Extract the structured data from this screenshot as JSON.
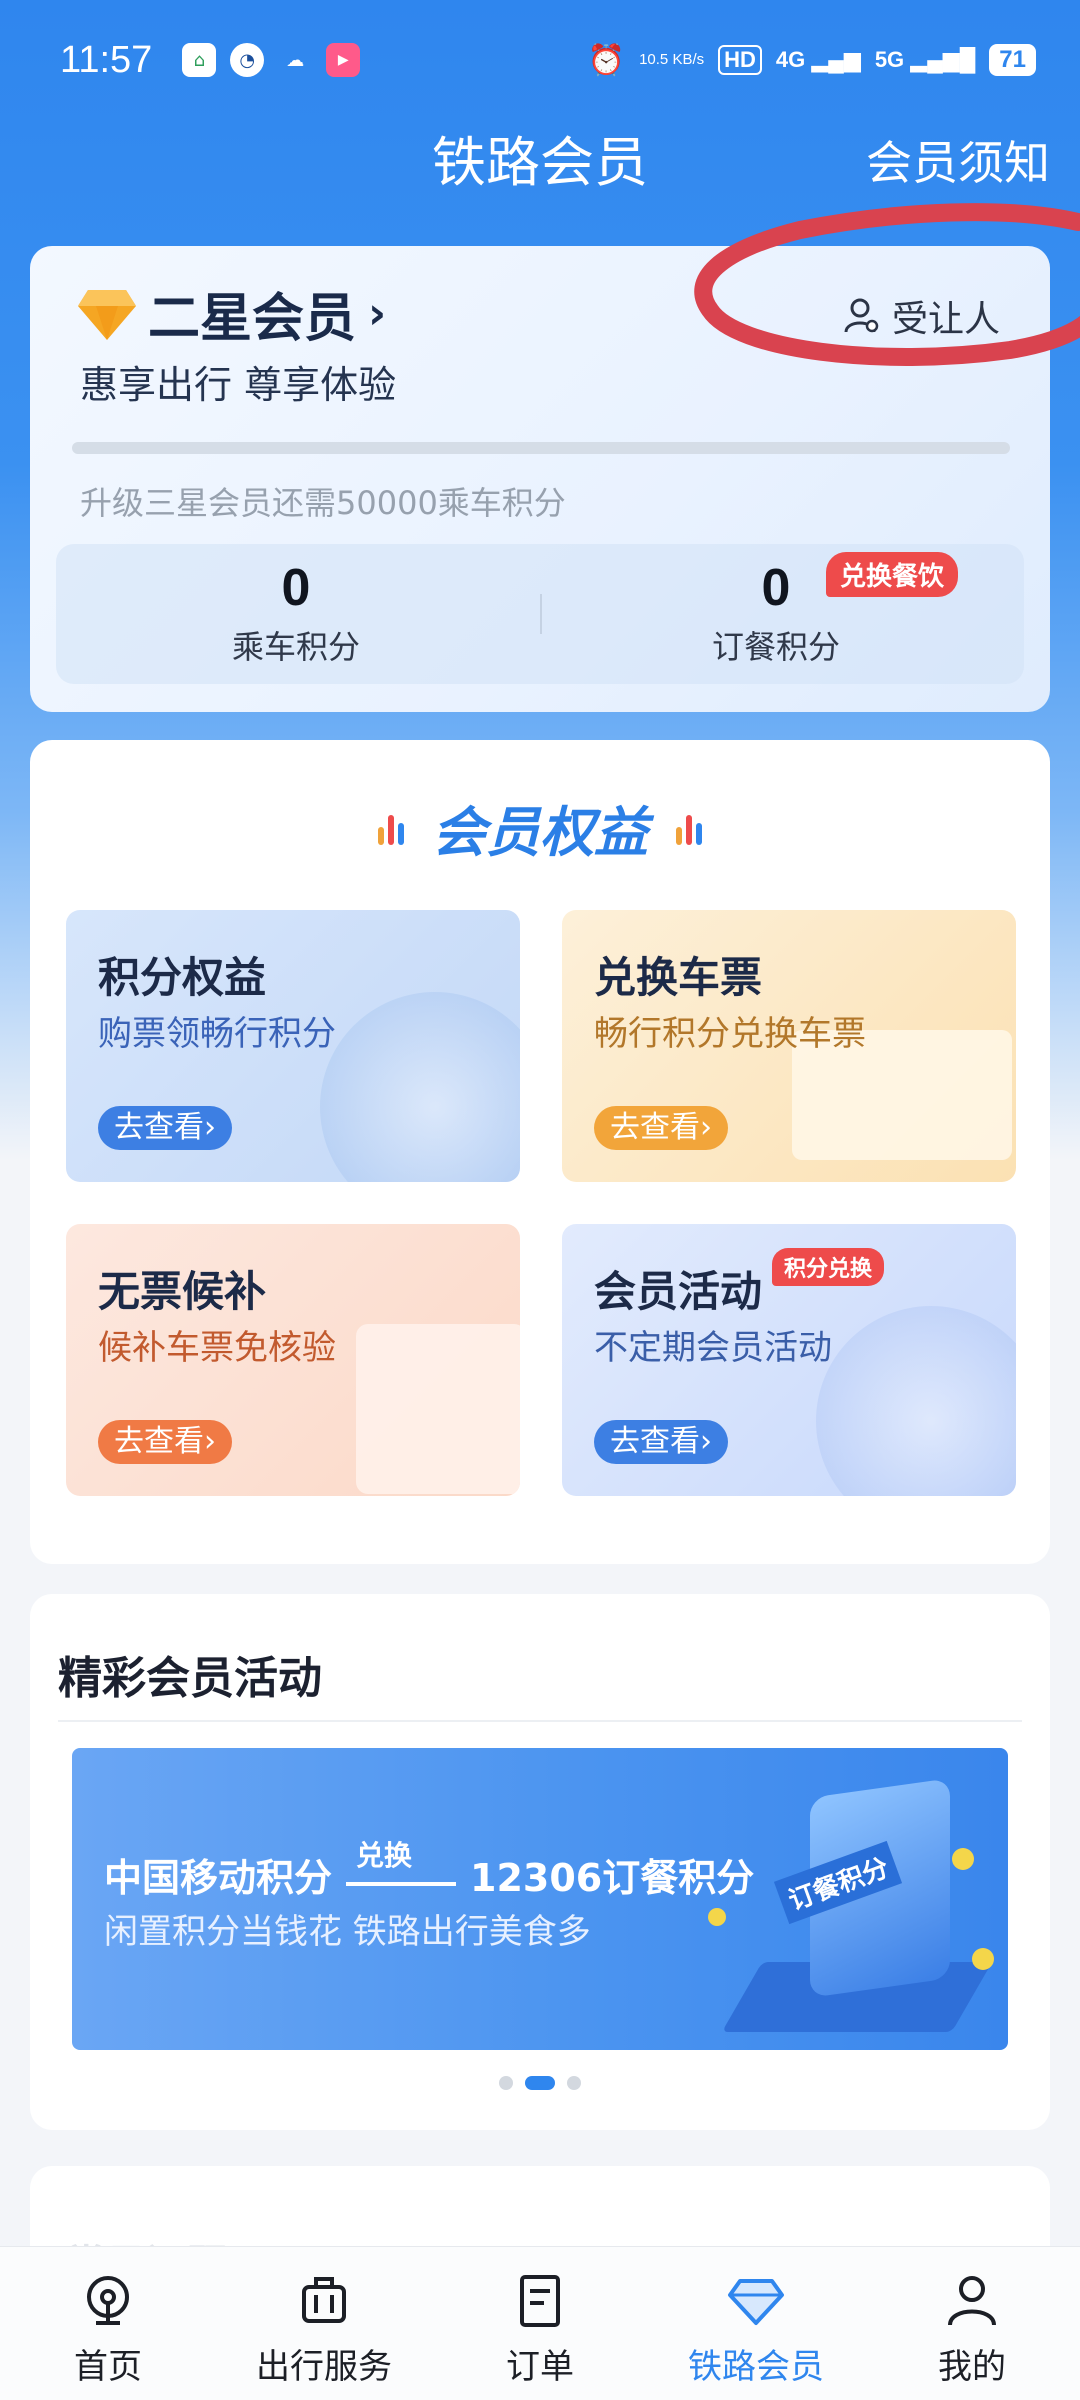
{
  "status_bar": {
    "time": "11:57",
    "network_speed": "10.5 KB/s",
    "hd_label": "HD",
    "signal_4g": "4G",
    "signal_5g": "5G",
    "battery": "71"
  },
  "header": {
    "title": "铁路会员",
    "notice_label": "会员须知"
  },
  "member": {
    "level": "二星会员",
    "slogan": "惠享出行 尊享体验",
    "beneficiary_label": "受让人",
    "progress_fraction": 0,
    "upgrade_hint": "升级三星会员还需50000乘车积分",
    "ride_points_value": "0",
    "ride_points_label": "乘车积分",
    "meal_points_value": "0",
    "meal_points_label": "订餐积分",
    "redeem_badge": "兑换餐饮"
  },
  "benefits": {
    "title": "会员权益",
    "tiles": [
      {
        "title": "积分权益",
        "subtitle": "购票领畅行积分",
        "button": "去查看›"
      },
      {
        "title": "兑换车票",
        "subtitle": "畅行积分兑换车票",
        "button": "去查看›"
      },
      {
        "title": "无票候补",
        "subtitle": "候补车票免核验",
        "button": "去查看›"
      },
      {
        "title": "会员活动",
        "subtitle": "不定期会员活动",
        "button": "去查看›",
        "badge": "积分兑换"
      }
    ]
  },
  "activities": {
    "title": "精彩会员活动",
    "banner": {
      "from": "中国移动积分",
      "arrow_label": "兑换",
      "to": "12306订餐积分",
      "subtitle": "闲置积分当钱花 铁路出行美食多",
      "phone_label": "订餐积分"
    },
    "carousel_dots": 3,
    "active_dot": 1
  },
  "next_section_title": "常见问题",
  "bottom_nav": [
    {
      "label": "首页",
      "icon": "home-icon"
    },
    {
      "label": "出行服务",
      "icon": "luggage-icon"
    },
    {
      "label": "订单",
      "icon": "order-icon"
    },
    {
      "label": "铁路会员",
      "icon": "diamond-icon",
      "active": true
    },
    {
      "label": "我的",
      "icon": "user-icon"
    }
  ],
  "colors": {
    "brand_blue": "#2f86ee",
    "badge_red": "#ee4b4b",
    "annotation_red": "#d9434f"
  }
}
